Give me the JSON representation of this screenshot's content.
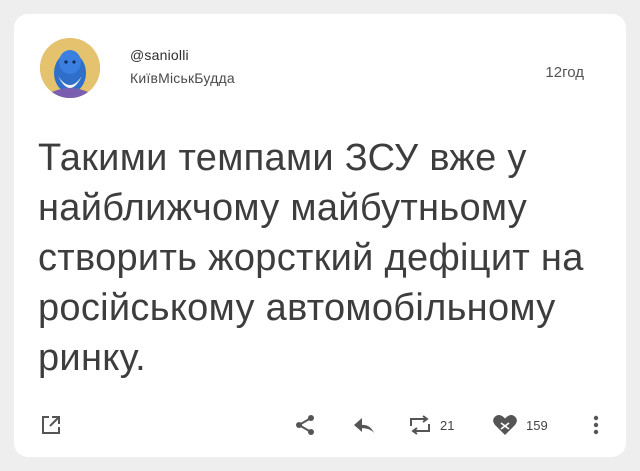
{
  "post": {
    "handle": "@saniolli",
    "display_name": "КиївМіськБудда",
    "time": "12год",
    "text": "Такими темпами ЗСУ вже у найближчому майбутньому створить жорсткий дефіцит на російському автомобільному ринку."
  },
  "actions": {
    "retweets": "21",
    "likes": "159"
  },
  "icons": {
    "open": "open-external-icon",
    "share": "share-icon",
    "reply": "reply-icon",
    "retweet": "retweet-icon",
    "like": "heart-icon",
    "more": "more-vertical-icon"
  }
}
